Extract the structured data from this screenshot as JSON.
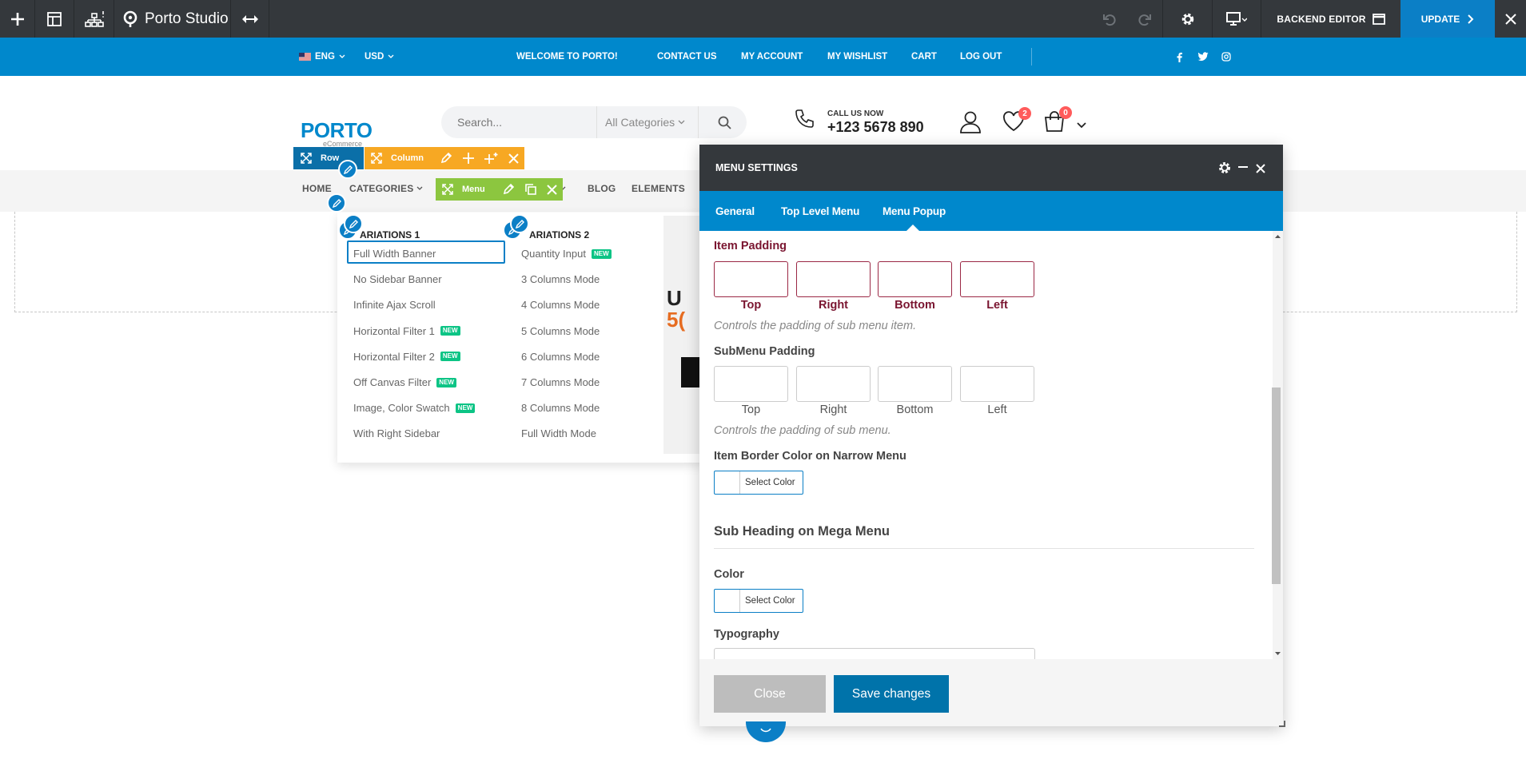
{
  "editor_bar": {
    "brand": "Porto Studio",
    "backend_editor": "BACKEND EDITOR",
    "update": "UPDATE"
  },
  "top_strip": {
    "language": "ENG",
    "currency": "USD",
    "welcome": "WELCOME TO PORTO!",
    "links": [
      "CONTACT US",
      "MY ACCOUNT",
      "MY WISHLIST",
      "CART",
      "LOG OUT"
    ]
  },
  "header": {
    "logo": "PORTO",
    "logo_sub": "eCommerce",
    "search_placeholder": "Search...",
    "category": "All Categories",
    "call_label": "CALL US NOW",
    "phone": "+123 5678 890",
    "wishlist_count": "2",
    "cart_count": "0"
  },
  "nav": {
    "items": [
      "HOME",
      "CATEGORIES",
      "BLOG",
      "ELEMENTS"
    ]
  },
  "builder": {
    "row": "Row",
    "column": "Column",
    "menu": "Menu"
  },
  "mega_menu": {
    "col1_heading": "ARIATIONS 1",
    "col2_heading": "ARIATIONS 2",
    "new_label": "NEW",
    "col1": [
      {
        "label": "Full Width Banner",
        "new": false
      },
      {
        "label": "No Sidebar Banner",
        "new": false
      },
      {
        "label": "Infinite Ajax Scroll",
        "new": false
      },
      {
        "label": "Horizontal Filter 1",
        "new": true
      },
      {
        "label": "Horizontal Filter 2",
        "new": true
      },
      {
        "label": "Off Canvas Filter",
        "new": true
      },
      {
        "label": "Image, Color Swatch",
        "new": true
      },
      {
        "label": "With Right Sidebar",
        "new": false
      }
    ],
    "col2": [
      {
        "label": "Quantity Input",
        "new": true
      },
      {
        "label": "3 Columns Mode",
        "new": false
      },
      {
        "label": "4 Columns Mode",
        "new": false
      },
      {
        "label": "5 Columns Mode",
        "new": false
      },
      {
        "label": "6 Columns Mode",
        "new": false
      },
      {
        "label": "7 Columns Mode",
        "new": false
      },
      {
        "label": "8 Columns Mode",
        "new": false
      },
      {
        "label": "Full Width Mode",
        "new": false
      }
    ],
    "banner_text_1": "U",
    "banner_text_2": "5("
  },
  "modal": {
    "title": "MENU SETTINGS",
    "tabs": [
      "General",
      "Top Level Menu",
      "Menu Popup"
    ],
    "active_tab": "Menu Popup",
    "item_padding": {
      "label": "Item Padding",
      "sides": [
        "Top",
        "Right",
        "Bottom",
        "Left"
      ],
      "help": "Controls the padding of sub menu item."
    },
    "submenu_padding": {
      "label": "SubMenu Padding",
      "sides": [
        "Top",
        "Right",
        "Bottom",
        "Left"
      ],
      "help": "Controls the padding of sub menu."
    },
    "border_color": {
      "label": "Item Border Color on Narrow Menu",
      "button": "Select Color"
    },
    "sub_heading": "Sub Heading on Mega Menu",
    "color": {
      "label": "Color",
      "button": "Select Color"
    },
    "typography": "Typography",
    "close": "Close",
    "save": "Save changes"
  },
  "colors": {
    "editor_dark": "#34383c",
    "brand_blue": "#0088cc",
    "error_red": "#7a1530",
    "column_orange": "#f7a823",
    "menu_green": "#8cc63f",
    "new_green": "#0cc485"
  }
}
